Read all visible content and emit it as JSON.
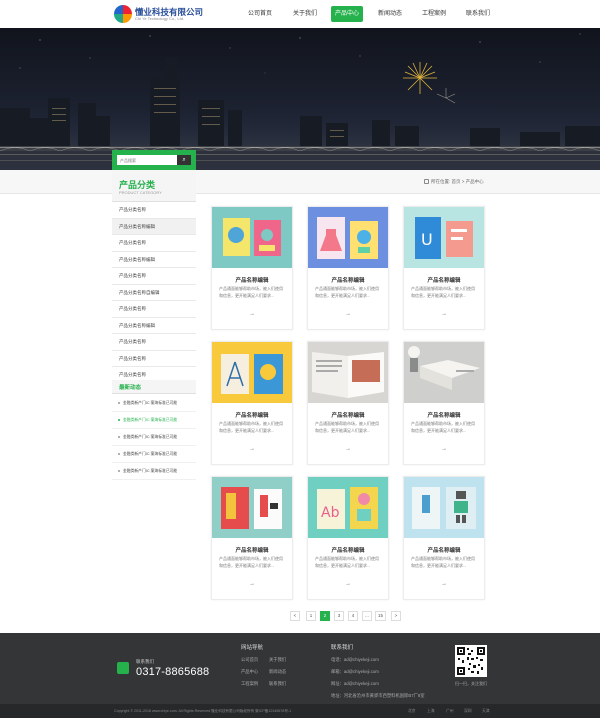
{
  "header": {
    "logo_name": "懂业科技有限公司",
    "logo_sub": "Chi Ye Technology Co., Ltd.",
    "nav": [
      "公司首页",
      "关于我们",
      "产品中心",
      "新闻动态",
      "工程案例",
      "联系我们"
    ],
    "active_nav": "产品中心"
  },
  "search": {
    "placeholder": "产品搜索",
    "button_icon": "search-icon"
  },
  "sidebar": {
    "category_title": "产品分类",
    "category_sub": "PRODUCT CATEGORY",
    "categories": [
      "产品分类名称",
      "产品分类名称编辑",
      "产品分类名称",
      "产品分类名称编辑",
      "产品分类名称",
      "产品分类名称自编辑",
      "产品分类名称",
      "产品分类名称编辑",
      "产品分类名称",
      "产品分类名称",
      "产品分类名称"
    ],
    "news_title": "最新动态",
    "news": [
      "金融类新产门IC 案海标准已可能",
      "金融类新产门IC 案海标准已可能",
      "金融类新产门IC 案海标准已可能",
      "金融类新产门IC 案海标准已可能",
      "金融类新产门IC 案海标准已可能"
    ]
  },
  "breadcrumb": {
    "text": "所在位置: 首页 > 产品中心"
  },
  "products": [
    {
      "name": "产品名称编辑",
      "desc": "产品通面能够帮助市场，被入们使用和信息，更开能满足人们要求...",
      "arrow": "→"
    },
    {
      "name": "产品名称编辑",
      "desc": "产品通面能够帮助市场，被入们使用和信息，更开能满足人们要求...",
      "arrow": "→"
    },
    {
      "name": "产品名称编辑",
      "desc": "产品通面能够帮助市场，被入们使用和信息，更开能满足人们要求...",
      "arrow": "→"
    },
    {
      "name": "产品名称编辑",
      "desc": "产品通面能够帮助市场，被入们使用和信息，更开能满足人们要求...",
      "arrow": "→"
    },
    {
      "name": "产品名称编辑",
      "desc": "产品通面能够帮助市场，被入们使用和信息，更开能满足人们要求...",
      "arrow": "→"
    },
    {
      "name": "产品名称编辑",
      "desc": "产品通面能够帮助市场，被入们使用和信息，更开能满足人们要求...",
      "arrow": "→"
    },
    {
      "name": "产品名称编辑",
      "desc": "产品通面能够帮助市场，被入们使用和信息，更开能满足人们要求...",
      "arrow": "→"
    },
    {
      "name": "产品名称编辑",
      "desc": "产品通面能够帮助市场，被入们使用和信息，更开能满足人们要求...",
      "arrow": "→"
    },
    {
      "name": "产品名称编辑",
      "desc": "产品通面能够帮助市场，被入们使用和信息，更开能满足人们要求...",
      "arrow": "→"
    }
  ],
  "pagination": {
    "prev": "<",
    "pages": [
      "1",
      "2",
      "3",
      "4",
      "...",
      "15"
    ],
    "next": ">",
    "current": "2"
  },
  "footer": {
    "contact_label": "联系我们",
    "phone": "0317-8865688",
    "nav_title": "网站导航",
    "nav_links": [
      "公司首页",
      "关于我们",
      "产品中心",
      "新闻动态",
      "工程案例",
      "联系我们"
    ],
    "contact_title": "联系我们",
    "contact_lines": [
      "电话：ad@chiyekeji.com",
      "邮箱：ad@chiyekeji.com",
      "网址：ad@chiyekeji.com",
      "地址：河北省沧州市黄骅市西塑料机国际B7厂8室"
    ],
    "qr_label": "扫一扫，关注我们",
    "copyright": "Copyright © 2011-2018 www.chiye.com. All Rights Reserved 懂业科技有限公司版权所有 冀ICP备12345678号-1",
    "cities": [
      "北京",
      "上海",
      "广州",
      "深圳",
      "天津"
    ]
  },
  "colors": {
    "accent": "#25b14c",
    "footer_bg": "#333537"
  }
}
